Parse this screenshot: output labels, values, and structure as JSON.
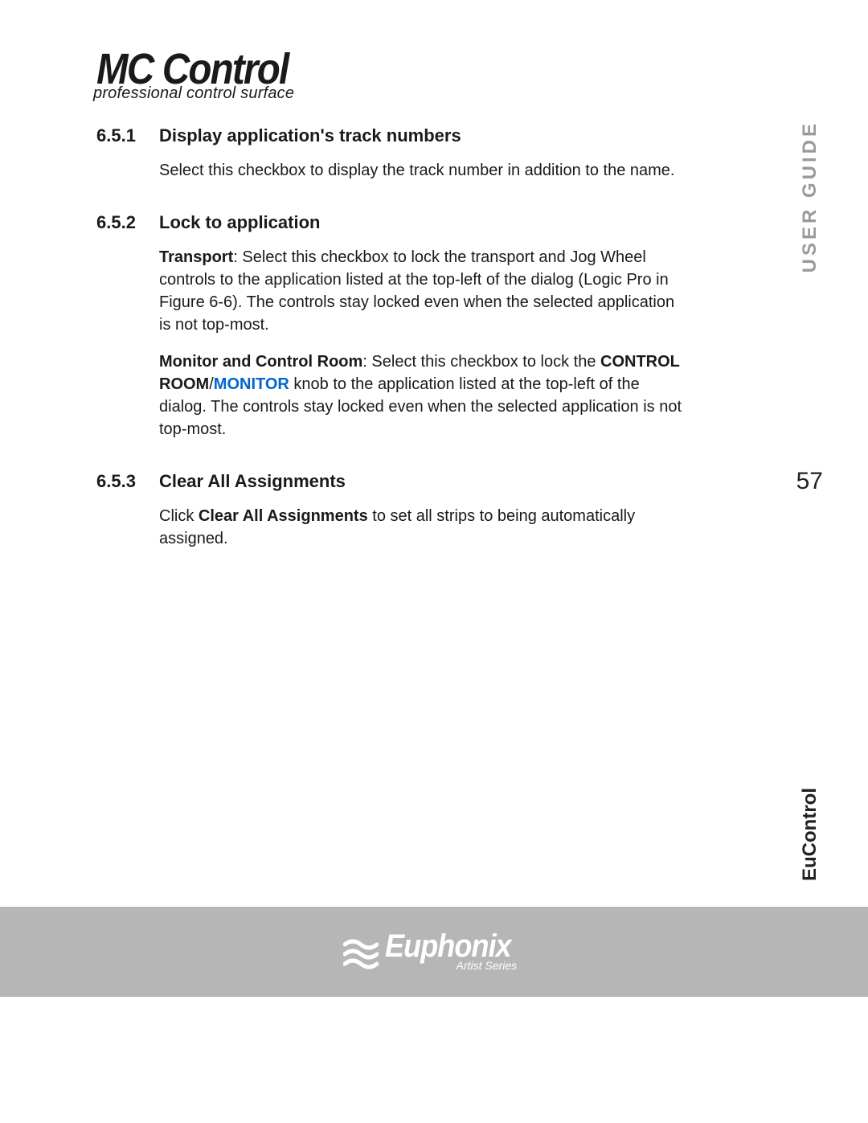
{
  "logo": {
    "title": "MC Control",
    "subtitle": "professional control surface"
  },
  "sideTop": "USER GUIDE",
  "pageNumber": "57",
  "sideBottom": "EuControl",
  "sections": [
    {
      "num": "6.5.1",
      "title": "Display application's track numbers",
      "para1": "Select this checkbox to display the track number in addition to the name."
    },
    {
      "num": "6.5.2",
      "title": "Lock to application",
      "p1_b": "Transport",
      "p1_rest": ": Select this checkbox to lock the transport and Jog Wheel controls to the application listed at the top-left of the dialog (Logic Pro in Figure 6-6). The controls stay locked even when the selected application is not top-most.",
      "p2_b1": "Monitor and Control Room",
      "p2_mid1": ": Select this checkbox to lock the ",
      "p2_b2": "CONTROL ROOM",
      "p2_slash": "/",
      "p2_link": "MONITOR",
      "p2_rest": " knob to the application listed at the top-left of the dialog. The controls stay locked even when the selected application is not top-most."
    },
    {
      "num": "6.5.3",
      "title": "Clear All Assignments",
      "p1_a": "Click ",
      "p1_b": "Clear All Assignments",
      "p1_c": " to set all strips to being automatically assigned."
    }
  ],
  "footer": {
    "brand": "Euphonix",
    "sub": "Artist Series"
  }
}
